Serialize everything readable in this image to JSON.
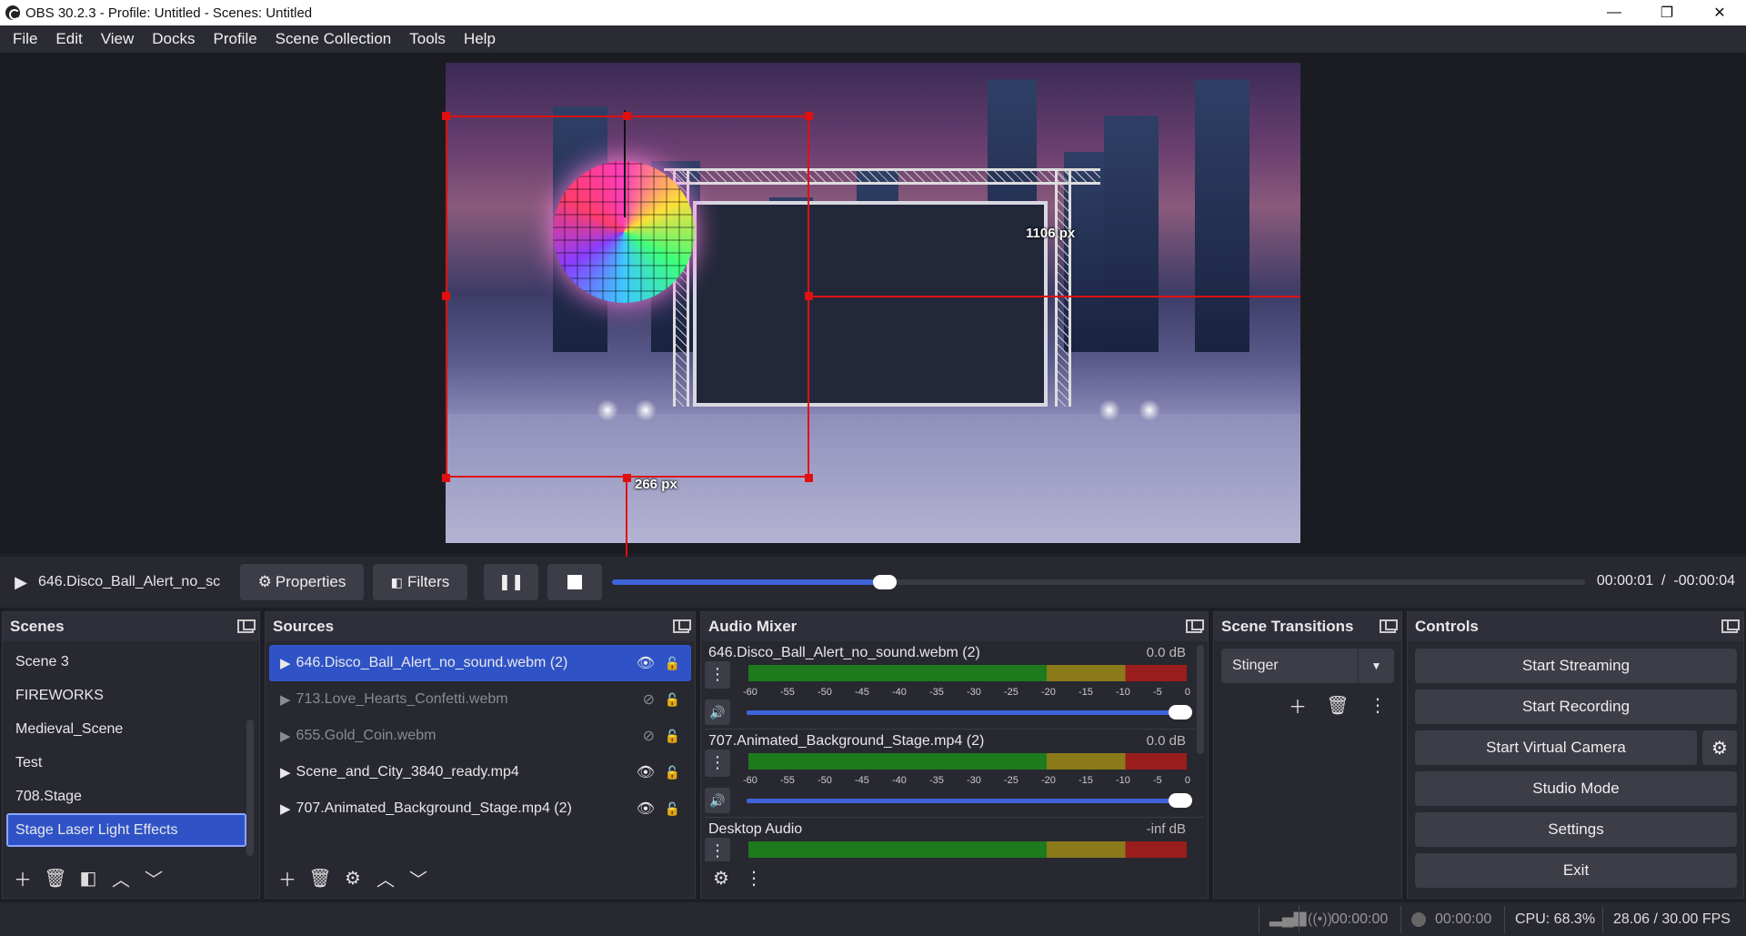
{
  "window": {
    "title": "OBS 30.2.3 - Profile: Untitled - Scenes: Untitled",
    "controls": [
      "—",
      "❐",
      "✕"
    ]
  },
  "menu": [
    "File",
    "Edit",
    "View",
    "Docks",
    "Profile",
    "Scene Collection",
    "Tools",
    "Help"
  ],
  "preview": {
    "width_label": "1106 px",
    "height_label": "266 px"
  },
  "media": {
    "source_name": "646.Disco_Ball_Alert_no_sc",
    "properties_label": "Properties",
    "filters_label": "Filters",
    "time_elapsed": "00:00:01",
    "time_sep": "/",
    "time_remaining": "-00:00:04",
    "progress": 0.28
  },
  "scenes": {
    "title": "Scenes",
    "items": [
      "Scene 3",
      "FIREWORKS",
      "Medieval_Scene",
      "Test",
      "708.Stage",
      "Stage Laser Light Effects"
    ],
    "selected": "Stage Laser Light Effects"
  },
  "sources": {
    "title": "Sources",
    "items": [
      {
        "name": "646.Disco_Ball_Alert_no_sound.webm (2)",
        "visible": true,
        "selected": true
      },
      {
        "name": "713.Love_Hearts_Confetti.webm",
        "visible": false
      },
      {
        "name": "655.Gold_Coin.webm",
        "visible": false
      },
      {
        "name": "Scene_and_City_3840_ready.mp4",
        "visible": true
      },
      {
        "name": "707.Animated_Background_Stage.mp4 (2)",
        "visible": true
      }
    ]
  },
  "mixer": {
    "title": "Audio Mixer",
    "scale": [
      "-60",
      "-55",
      "-50",
      "-45",
      "-40",
      "-35",
      "-30",
      "-25",
      "-20",
      "-15",
      "-10",
      "-5",
      "0"
    ],
    "channels": [
      {
        "name": "646.Disco_Ball_Alert_no_sound.webm (2)",
        "level": "0.0 dB"
      },
      {
        "name": "707.Animated_Background_Stage.mp4 (2)",
        "level": "0.0 dB"
      },
      {
        "name": "Desktop Audio",
        "level": "-inf dB"
      }
    ]
  },
  "transitions": {
    "title": "Scene Transitions",
    "selected": "Stinger"
  },
  "controls": {
    "title": "Controls",
    "start_streaming": "Start Streaming",
    "start_recording": "Start Recording",
    "start_virtual_camera": "Start Virtual Camera",
    "studio_mode": "Studio Mode",
    "settings": "Settings",
    "exit": "Exit"
  },
  "status": {
    "stream_time": "00:00:00",
    "record_time": "00:00:00",
    "cpu": "CPU: 68.3%",
    "fps": "28.06 / 30.00 FPS"
  },
  "colors": {
    "accent": "#2f53c7",
    "guide": "#e01010"
  }
}
